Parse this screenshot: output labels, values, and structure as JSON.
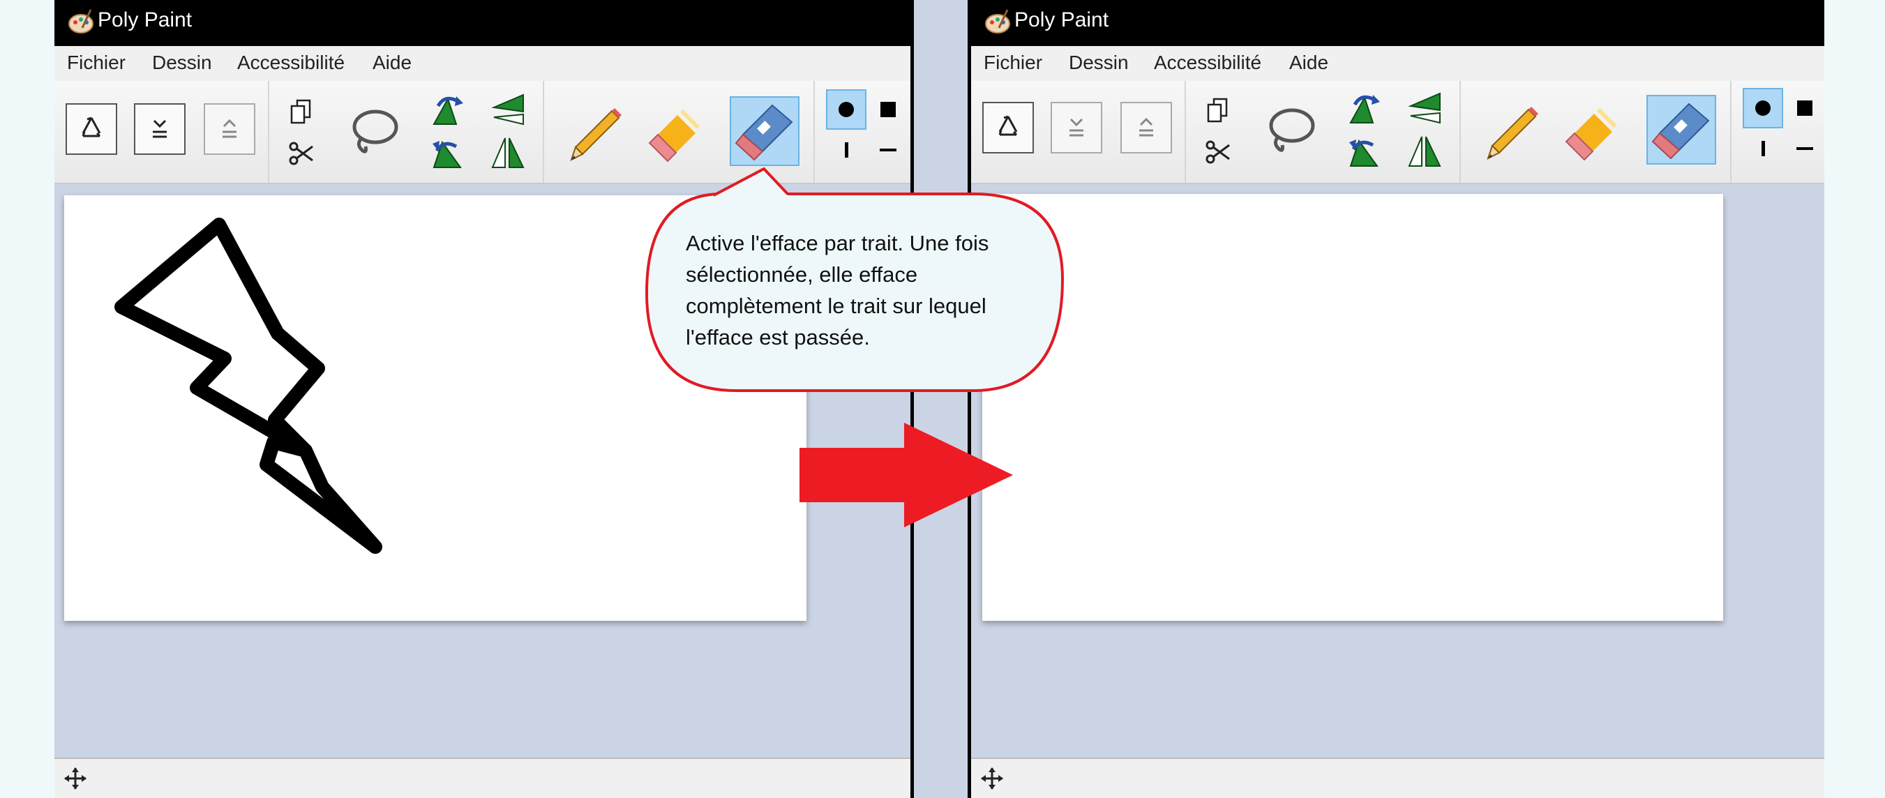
{
  "left": {
    "app_title": "Poly Paint",
    "menu": [
      "Fichier",
      "Dessin",
      "Accessibilité",
      "Aide"
    ]
  },
  "right": {
    "app_title": "Poly Paint",
    "menu": [
      "Fichier",
      "Dessin",
      "Accessibilité",
      "Aide"
    ]
  },
  "tooltip": {
    "text": "Active l'efface par trait. Une fois sélectionnée, elle efface complètement le trait sur lequel l'efface est passée."
  },
  "colors": {
    "tooltip_border": "#e01b24",
    "tooltip_bg": "#eef8fb",
    "arrow": "#ed1c24",
    "selected_tool": "#aed8f5"
  },
  "icons": [
    "palette-icon",
    "recycle-icon",
    "stack-down-icon",
    "stack-up-icon",
    "copy-icon",
    "scissors-icon",
    "lasso-icon",
    "rotate-icon",
    "flip-icon",
    "pencil-icon",
    "stroke-eraser-icon",
    "point-eraser-icon",
    "circle-tip-icon",
    "square-tip-icon",
    "vertical-tip-icon",
    "horizontal-tip-icon",
    "move-icon"
  ]
}
